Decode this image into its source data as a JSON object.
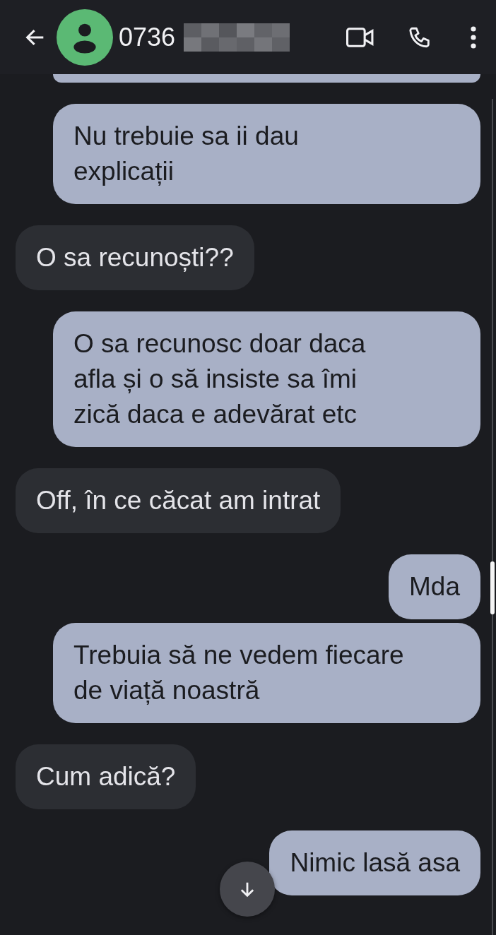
{
  "header": {
    "contact": "0736"
  },
  "messages": [
    {
      "kind": "sent",
      "text": "Nu trebuie sa ii dau\nexplicații"
    },
    {
      "kind": "received",
      "text": "O sa recunoști??"
    },
    {
      "kind": "sent",
      "text": "O sa recunosc doar daca\nafla și o să insiste sa îmi\nzică daca e adevărat etc"
    },
    {
      "kind": "received",
      "text": "Off, în ce căcat am intrat"
    },
    {
      "kind": "sent",
      "text": "Mda"
    },
    {
      "kind": "sent",
      "text": "Trebuia să ne vedem fiecare\nde viață noastră"
    },
    {
      "kind": "received",
      "text": "Cum adică?"
    },
    {
      "kind": "sent",
      "text": "Nimic lasă asa"
    }
  ]
}
